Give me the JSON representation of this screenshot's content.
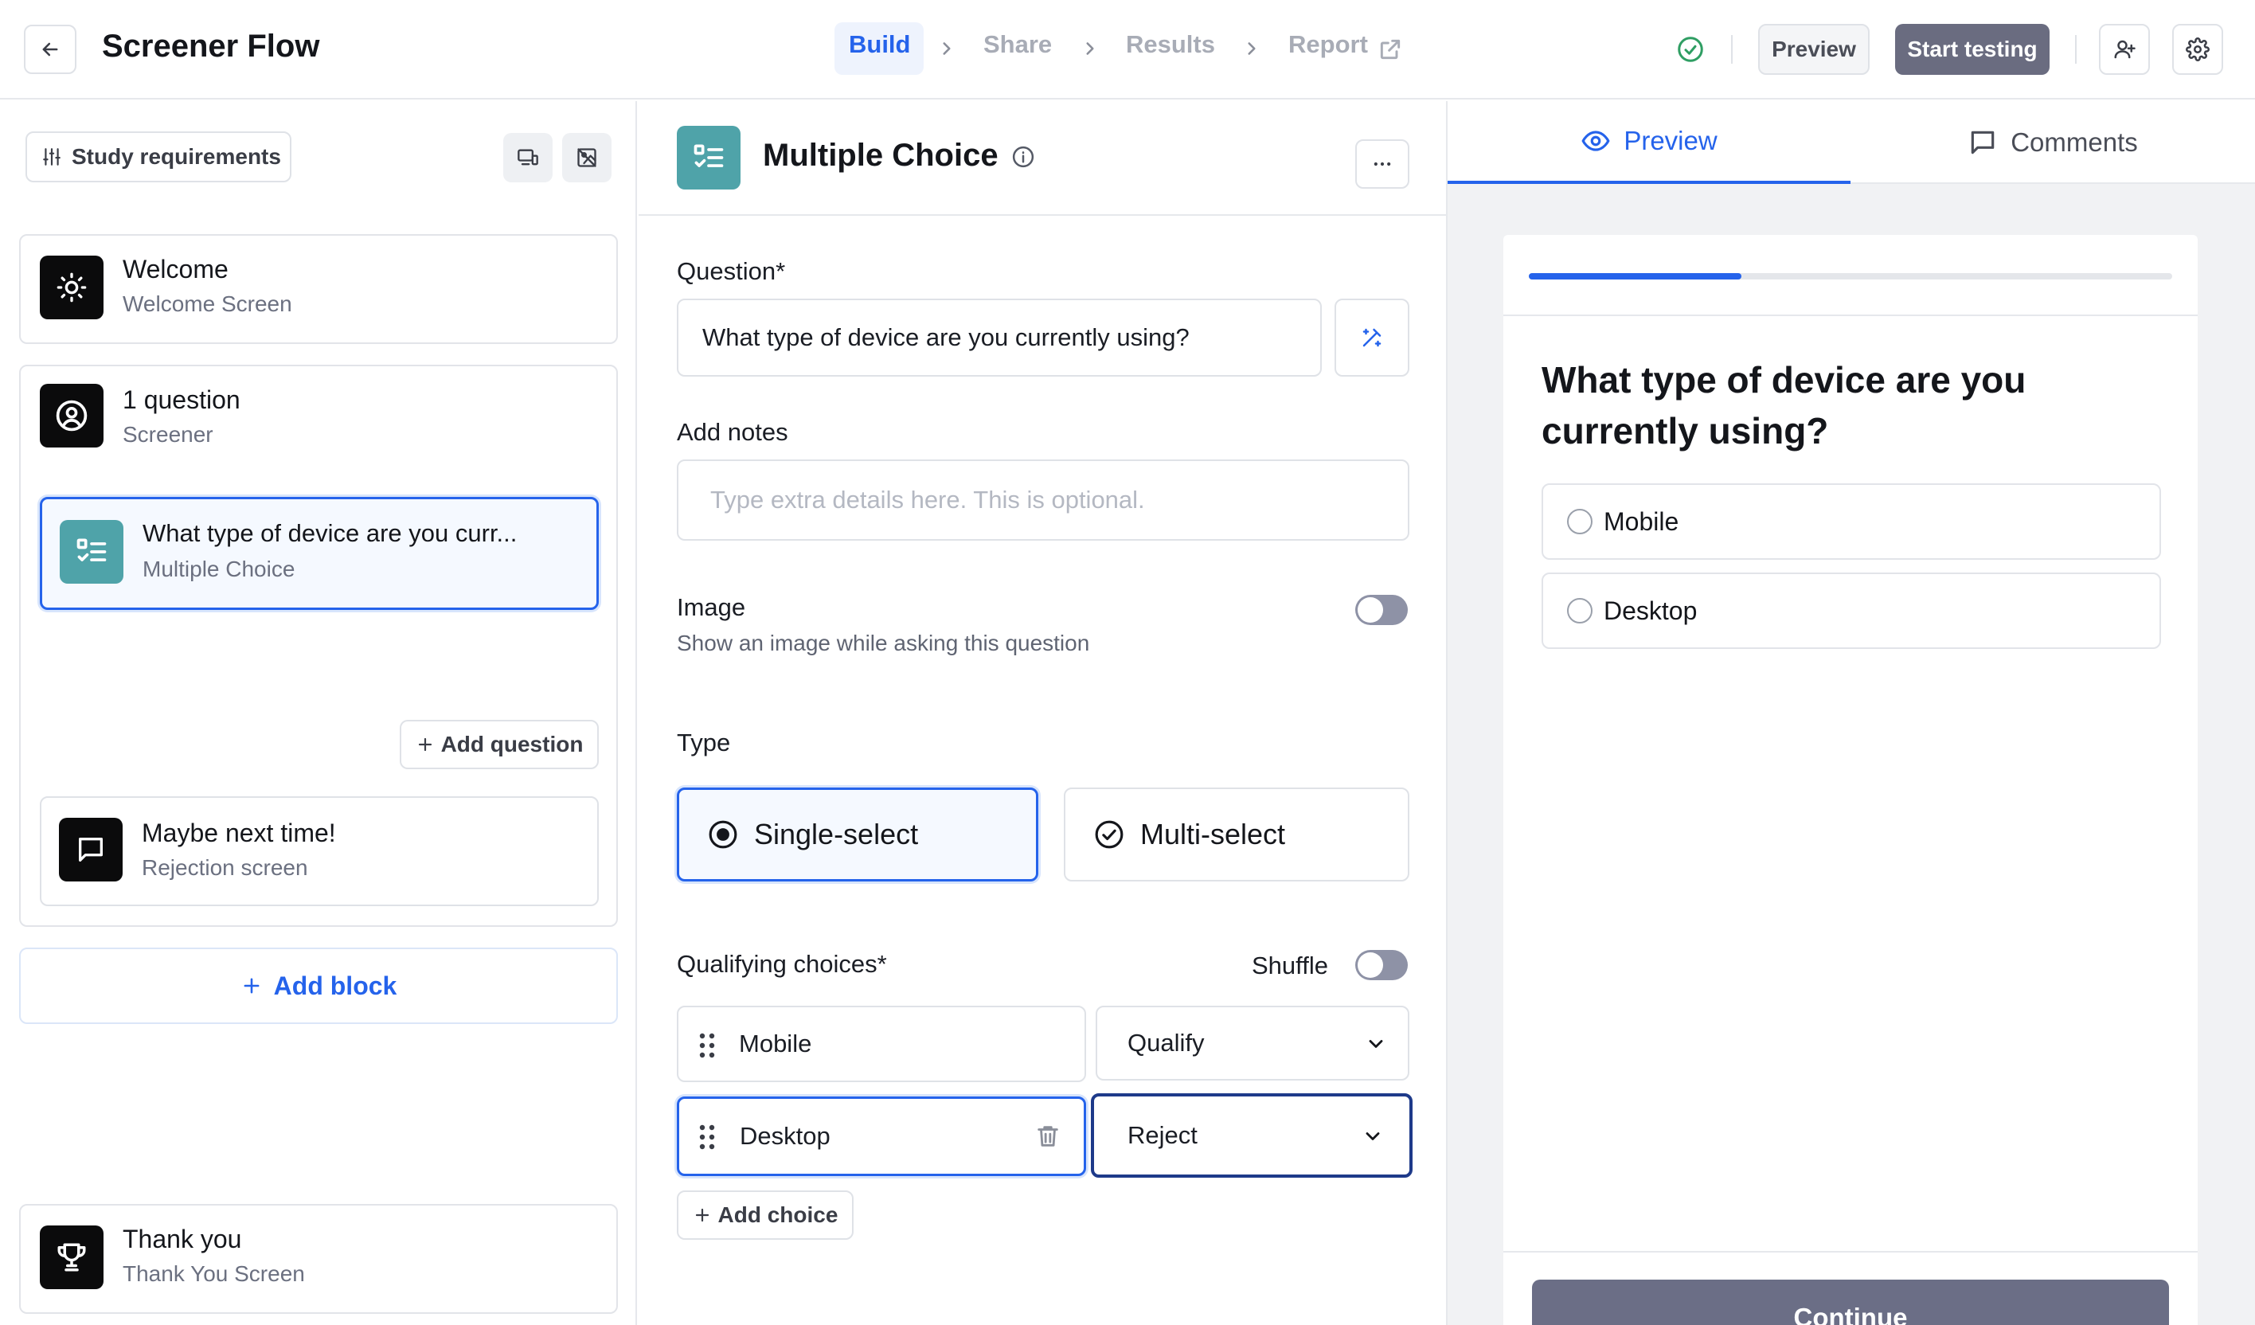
{
  "header": {
    "title": "Screener Flow",
    "steps": [
      "Build",
      "Share",
      "Results",
      "Report"
    ],
    "preview_label": "Preview",
    "start_testing_label": "Start testing"
  },
  "left": {
    "study_requirements_label": "Study requirements",
    "welcome": {
      "title": "Welcome",
      "subtitle": "Welcome Screen"
    },
    "screener": {
      "title": "1 question",
      "subtitle": "Screener"
    },
    "question_item": {
      "title": "What type of device are you curr...",
      "subtitle": "Multiple Choice"
    },
    "add_question_label": "Add question",
    "rejection": {
      "title": "Maybe next time!",
      "subtitle": "Rejection screen"
    },
    "add_block_label": "Add block",
    "thank_you": {
      "title": "Thank you",
      "subtitle": "Thank You Screen"
    }
  },
  "middle": {
    "title": "Multiple Choice",
    "question_label": "Question*",
    "question_value": "What type of device are you currently using?",
    "notes_label": "Add notes",
    "notes_placeholder": "Type extra details here. This is optional.",
    "image_label": "Image",
    "image_hint": "Show an image while asking this question",
    "image_enabled": false,
    "type_label": "Type",
    "type_options": [
      "Single-select",
      "Multi-select"
    ],
    "type_selected": "Single-select",
    "choices_label": "Qualifying choices*",
    "shuffle_label": "Shuffle",
    "shuffle_enabled": false,
    "choices": [
      {
        "label": "Mobile",
        "action": "Qualify"
      },
      {
        "label": "Desktop",
        "action": "Reject"
      }
    ],
    "add_choice_label": "Add choice"
  },
  "right": {
    "tabs": [
      "Preview",
      "Comments"
    ],
    "active_tab": "Preview",
    "progress": 0.33,
    "question": "What type of device are you currently using?",
    "options": [
      "Mobile",
      "Desktop"
    ],
    "continue_label": "Continue"
  },
  "colors": {
    "accent": "#2563eb",
    "selected_bg": "#f5f9ff",
    "question_icon_bg": "#4fa3a9",
    "start_testing_bg": "#6a6c80",
    "continue_bg": "#6b6e86",
    "toggle_off": "#8e92a6"
  }
}
